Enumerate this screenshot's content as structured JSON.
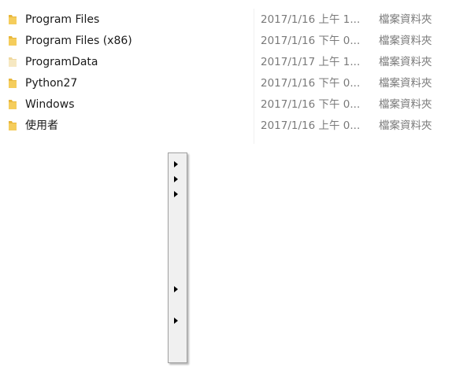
{
  "files": [
    {
      "name": "Program Files",
      "date": "2017/1/16 上午 1...",
      "type": "檔案資料夾",
      "icon": "folder-icon",
      "hidden": false
    },
    {
      "name": "Program Files (x86)",
      "date": "2017/1/16 下午 0...",
      "type": "檔案資料夾",
      "icon": "folder-icon",
      "hidden": false
    },
    {
      "name": "ProgramData",
      "date": "2017/1/17 上午 1...",
      "type": "檔案資料夾",
      "icon": "folder-icon",
      "hidden": true
    },
    {
      "name": "Python27",
      "date": "2017/1/16 下午 0...",
      "type": "檔案資料夾",
      "icon": "folder-icon",
      "hidden": false
    },
    {
      "name": "Windows",
      "date": "2017/1/16 下午 0...",
      "type": "檔案資料夾",
      "icon": "folder-icon",
      "hidden": false
    },
    {
      "name": "使用者",
      "date": "2017/1/16 上午 0...",
      "type": "檔案資料夾",
      "icon": "folder-icon",
      "hidden": false
    }
  ],
  "colors": {
    "folder": "#e8b73c",
    "folder_light": "#f5cd5c",
    "folder_hidden": "#f3e2b3",
    "secondary_text": "#7a7a7a",
    "menu_bg": "#f0f0f0",
    "menu_border": "#a0a0a0"
  },
  "context_menu": {
    "submenu_items": [
      {
        "icon": "submenu-arrow-icon"
      },
      {
        "icon": "submenu-arrow-icon"
      },
      {
        "icon": "submenu-arrow-icon"
      },
      {
        "icon": "submenu-arrow-icon"
      },
      {
        "icon": "submenu-arrow-icon"
      }
    ]
  }
}
